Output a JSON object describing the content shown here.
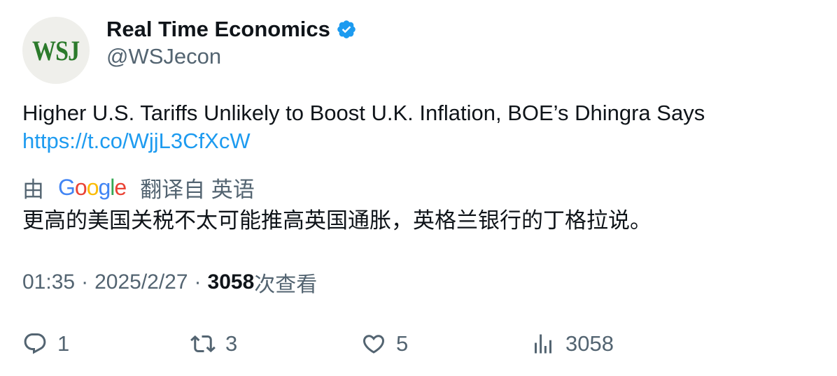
{
  "author": {
    "avatar_text": "WSJ",
    "display_name": "Real Time Economics",
    "handle": "@WSJecon",
    "verified": true
  },
  "tweet": {
    "text": "Higher U.S. Tariffs Unlikely to Boost U.K. Inflation, BOE’s Dhingra Says",
    "link": "https://t.co/WjjL3CfXcW"
  },
  "translation": {
    "prefix": "由",
    "provider": "Google",
    "suffix": "翻译自 英语",
    "text": "更高的美国关税不太可能推高英国通胀，英格兰银行的丁格拉说。"
  },
  "meta": {
    "time": "01:35",
    "separator": "·",
    "date": "2025/2/27",
    "views": "3058",
    "views_label": "次查看"
  },
  "actions": {
    "replies": "1",
    "retweets": "3",
    "likes": "5",
    "views": "3058"
  },
  "colors": {
    "link": "#1d9bf0",
    "verified": "#1d9bf0",
    "secondary_text": "#536471",
    "primary_text": "#0f1419",
    "avatar_bg": "#efefeb",
    "avatar_logo": "#2b7a2b"
  },
  "icons": {
    "reply": "reply-icon",
    "retweet": "retweet-icon",
    "like": "heart-icon",
    "views": "analytics-icon",
    "verified": "verified-badge-icon"
  }
}
